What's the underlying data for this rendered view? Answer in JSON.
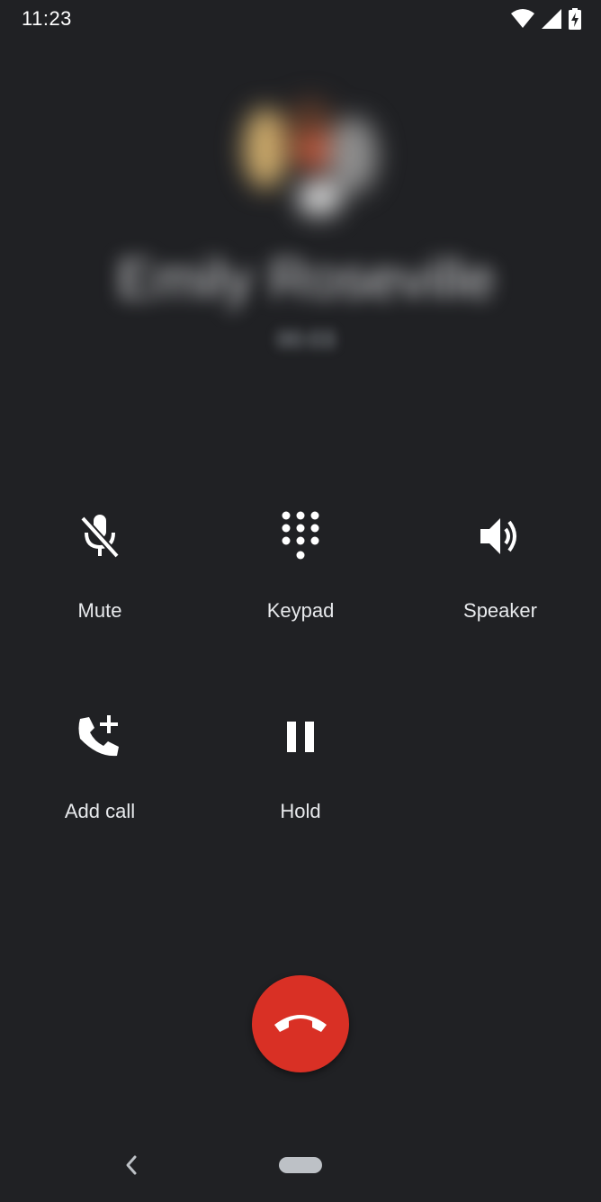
{
  "status_bar": {
    "time": "11:23",
    "icons": [
      "wifi-icon",
      "cell-signal-icon",
      "battery-charging-icon"
    ]
  },
  "caller": {
    "name": "Emily Roseville",
    "status": "00:03"
  },
  "controls": [
    {
      "id": "mute",
      "label": "Mute",
      "icon": "mic-off-icon"
    },
    {
      "id": "keypad",
      "label": "Keypad",
      "icon": "dialpad-icon"
    },
    {
      "id": "speaker",
      "label": "Speaker",
      "icon": "volume-icon"
    },
    {
      "id": "add_call",
      "label": "Add call",
      "icon": "add-call-icon"
    },
    {
      "id": "hold",
      "label": "Hold",
      "icon": "pause-icon"
    }
  ],
  "end_call": {
    "icon": "call-end-icon"
  },
  "nav": {
    "back_icon": "back-icon",
    "home_icon": "home-pill-icon"
  },
  "colors": {
    "background": "#202124",
    "end_call": "#d93025",
    "text": "#e8eaed"
  }
}
